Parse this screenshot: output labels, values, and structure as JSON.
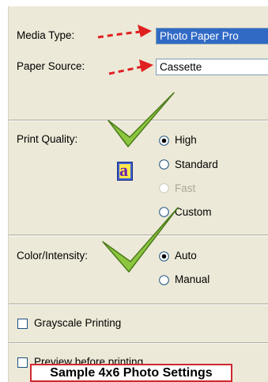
{
  "media_type": {
    "label": "Media Type:",
    "value": "Photo Paper Pro"
  },
  "paper_source": {
    "label": "Paper Source:",
    "value": "Cassette"
  },
  "print_quality": {
    "label": "Print Quality:",
    "options": [
      {
        "label": "High",
        "selected": true,
        "disabled": false
      },
      {
        "label": "Standard",
        "selected": false,
        "disabled": false
      },
      {
        "label": "Fast",
        "selected": false,
        "disabled": true
      },
      {
        "label": "Custom",
        "selected": false,
        "disabled": false
      }
    ]
  },
  "color_intensity": {
    "label": "Color/Intensity:",
    "options": [
      {
        "label": "Auto",
        "selected": true
      },
      {
        "label": "Manual",
        "selected": false
      }
    ]
  },
  "grayscale": {
    "label": "Grayscale Printing",
    "checked": false
  },
  "preview": {
    "label": "Preview before printing",
    "checked": false
  },
  "quality_icon": {
    "letter": "a"
  },
  "caption": "Sample 4x6 Photo Settings",
  "colors": {
    "arrow": "#e02020",
    "checkmark": "#8cc63f",
    "selection": "#316ac5"
  }
}
